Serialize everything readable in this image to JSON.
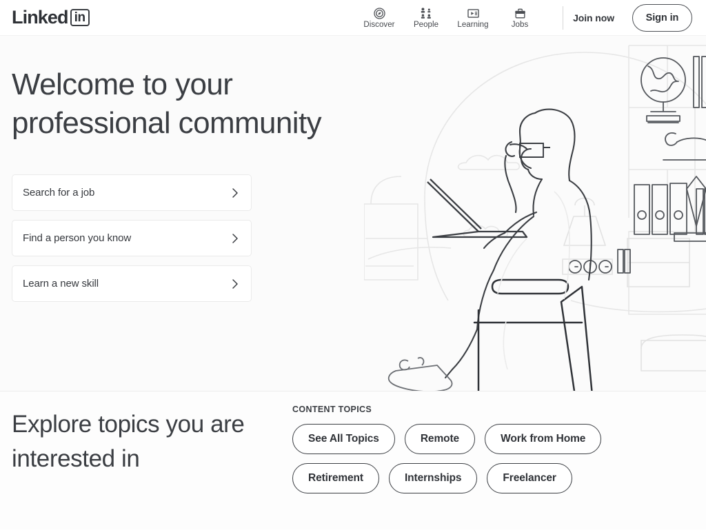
{
  "header": {
    "logo": {
      "word": "Linked",
      "badge": "in"
    },
    "nav_items": [
      {
        "label": "Discover",
        "icon": "compass-icon"
      },
      {
        "label": "People",
        "icon": "people-grid-icon"
      },
      {
        "label": "Learning",
        "icon": "video-play-icon"
      },
      {
        "label": "Jobs",
        "icon": "briefcase-icon"
      }
    ],
    "join_now": "Join now",
    "sign_in": "Sign in"
  },
  "hero": {
    "title": "Welcome to your professional community",
    "cards": [
      {
        "label": "Search for a job"
      },
      {
        "label": "Find a person you know"
      },
      {
        "label": "Learn a new skill"
      }
    ],
    "illustration": "person-at-laptop-in-chair-with-bookshelf-line-art"
  },
  "topics": {
    "title": "Explore topics you are interested in",
    "label": "CONTENT TOPICS",
    "rows": [
      [
        {
          "label": "See All Topics"
        },
        {
          "label": "Remote"
        },
        {
          "label": "Work from Home"
        }
      ],
      [
        {
          "label": "Retirement"
        },
        {
          "label": "Internships"
        },
        {
          "label": "Freelancer"
        }
      ]
    ]
  },
  "colors": {
    "text": "#32353a",
    "hero_bg": "#fbfbfb",
    "border": "#eaeaea",
    "art_dark": "#4a4d52",
    "art_light": "#e4e4e4"
  }
}
